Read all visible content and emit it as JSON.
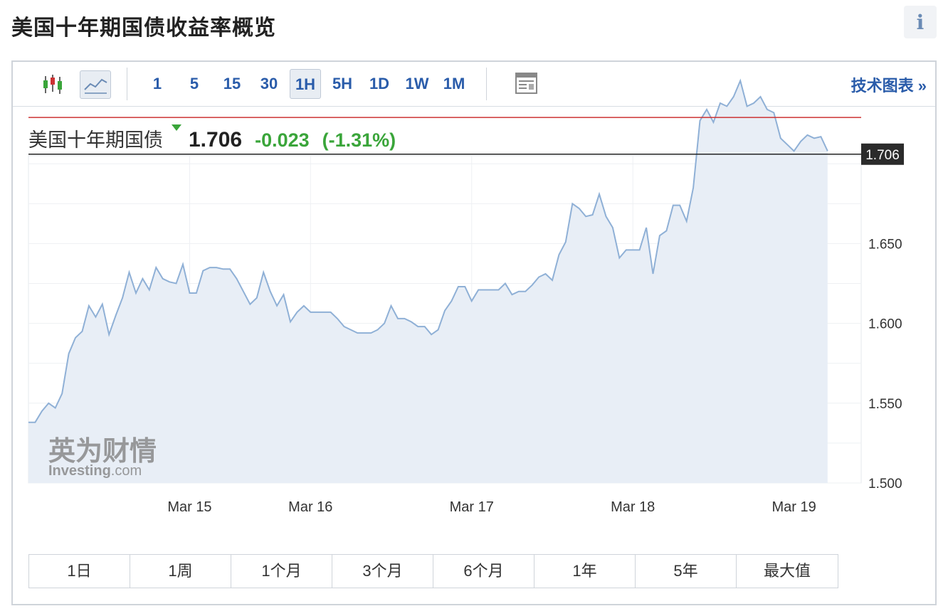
{
  "page": {
    "title": "美国十年期国债收益率概览",
    "info_label": "i"
  },
  "toolbar": {
    "timeframes": [
      "1",
      "5",
      "15",
      "30",
      "1H",
      "5H",
      "1D",
      "1W",
      "1M"
    ],
    "active_timeframe": "1H",
    "tech_chart_label": "技术图表 »"
  },
  "quote": {
    "name": "美国十年期国债",
    "price": "1.706",
    "change": "-0.023",
    "change_pct": "(-1.31%)"
  },
  "watermark": {
    "cn": "英为财情",
    "en": "Investing",
    "suffix": ".com"
  },
  "range_buttons": [
    "1日",
    "1周",
    "1个月",
    "3个月",
    "6个月",
    "1年",
    "5年",
    "最大值"
  ],
  "colors": {
    "line": "#8fb0d6",
    "area": "#e8eef6",
    "up_down_green": "#3aa53a",
    "ref_line_red": "#cc3333",
    "current_line": "#222222",
    "link_blue": "#2a5caa"
  },
  "chart_data": {
    "type": "area",
    "ylim": [
      1.5,
      1.705
    ],
    "yticks": [
      1.5,
      1.55,
      1.6,
      1.65
    ],
    "ytick_labels": [
      "1.500",
      "1.550",
      "1.600",
      "1.650"
    ],
    "xlim": [
      0,
      124
    ],
    "xticks": [
      {
        "label": "Mar 15",
        "x": 24
      },
      {
        "label": "Mar 16",
        "x": 42
      },
      {
        "label": "Mar 17",
        "x": 66
      },
      {
        "label": "Mar 18",
        "x": 90
      },
      {
        "label": "Mar 19",
        "x": 114
      }
    ],
    "grid": true,
    "reference_line": 1.729,
    "current_value": 1.706,
    "current_label": "1.706",
    "values": [
      1.538,
      1.538,
      1.545,
      1.55,
      1.547,
      1.556,
      1.581,
      1.591,
      1.595,
      1.611,
      1.604,
      1.612,
      1.593,
      1.605,
      1.616,
      1.632,
      1.619,
      1.628,
      1.621,
      1.635,
      1.628,
      1.626,
      1.625,
      1.637,
      1.619,
      1.619,
      1.633,
      1.635,
      1.635,
      1.634,
      1.634,
      1.628,
      1.62,
      1.612,
      1.616,
      1.632,
      1.62,
      1.611,
      1.618,
      1.601,
      1.607,
      1.611,
      1.607,
      1.607,
      1.607,
      1.607,
      1.603,
      1.598,
      1.596,
      1.594,
      1.594,
      1.594,
      1.596,
      1.6,
      1.611,
      1.603,
      1.603,
      1.601,
      1.598,
      1.598,
      1.593,
      1.596,
      1.608,
      1.614,
      1.623,
      1.623,
      1.614,
      1.621,
      1.621,
      1.621,
      1.621,
      1.625,
      1.618,
      1.62,
      1.62,
      1.624,
      1.629,
      1.631,
      1.627,
      1.643,
      1.651,
      1.675,
      1.672,
      1.667,
      1.668,
      1.681,
      1.667,
      1.66,
      1.641,
      1.646,
      1.646,
      1.646,
      1.66,
      1.631,
      1.655,
      1.658,
      1.674,
      1.674,
      1.664,
      1.685,
      1.727,
      1.734,
      1.726,
      1.738,
      1.736,
      1.742,
      1.752,
      1.736,
      1.738,
      1.742,
      1.734,
      1.732,
      1.716,
      1.712,
      1.708,
      1.714,
      1.718,
      1.716,
      1.717,
      1.708
    ]
  }
}
